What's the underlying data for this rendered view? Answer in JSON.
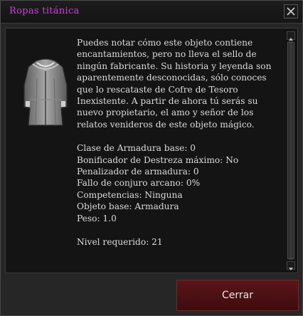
{
  "window": {
    "title": "Ropas titánica"
  },
  "item": {
    "icon": "robe-armor-icon",
    "description": "Puedes notar cómo este objeto contiene encantamientos, pero no lleva el sello de ningún fabricante. Su historia y leyenda son aparentemente desconocidas, sólo conoces que lo rescataste de Cofre de Tesoro Inexistente. A partir de ahora tú serás su nuevo propietario, el amo y señor de los relatos venideros de este objeto mágico.",
    "stats": [
      "Clase de Armadura base: 0",
      "Bonificador de Destreza máximo: No",
      "Penalizador de armadura: 0",
      "Fallo de conjuro arcano: 0%",
      "Competencias: Ninguna",
      "Objeto base: Armadura",
      "Peso: 1.0"
    ],
    "level_required": "Nivel requerido: 21"
  },
  "buttons": {
    "close_main": "Cerrar",
    "close_icon": "close-x-icon"
  },
  "colors": {
    "title": "#d23be0",
    "button_bg": "#4a1114",
    "text": "#dcdcdc",
    "background": "#141414"
  }
}
